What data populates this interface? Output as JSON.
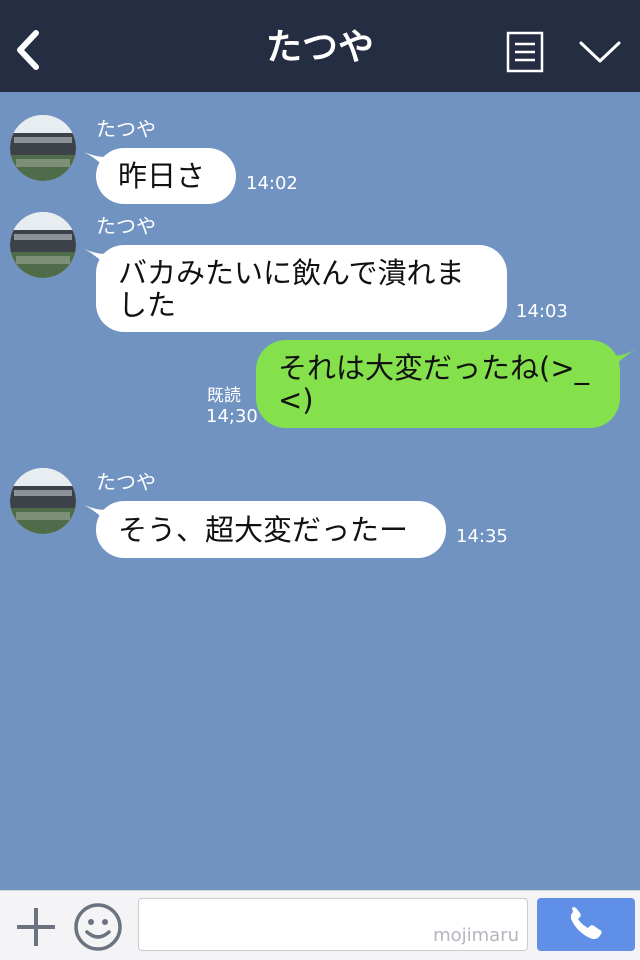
{
  "header": {
    "title": "たつや",
    "back_icon": "chevron-left-icon",
    "menu_icon": "list-icon",
    "collapse_icon": "chevron-down-icon",
    "background": "#252d42"
  },
  "chat": {
    "background": "#7193c1",
    "messages": [
      {
        "sender": "たつや",
        "text": "昨日さ",
        "time": "14:02",
        "direction": "incoming"
      },
      {
        "sender": "たつや",
        "text_lines": [
          "バカみたいに飲んで潰れま",
          "した"
        ],
        "time": "14:03",
        "direction": "incoming"
      },
      {
        "text_lines": [
          "それは大変だったね(>_",
          "<)"
        ],
        "read_label": "既読",
        "time": "14;30",
        "direction": "outgoing"
      },
      {
        "sender": "たつや",
        "text": "そう、超大変だったー",
        "time": "14:35",
        "direction": "incoming"
      }
    ]
  },
  "bottom_bar": {
    "plus_icon": "plus-icon",
    "emoji_icon": "smiley-icon",
    "input_value": "",
    "watermark": "mojimaru",
    "call_icon": "phone-icon"
  },
  "colors": {
    "incoming_bubble": "#ffffff",
    "outgoing_bubble": "#84e14b",
    "call_button": "#5f8fe6"
  }
}
